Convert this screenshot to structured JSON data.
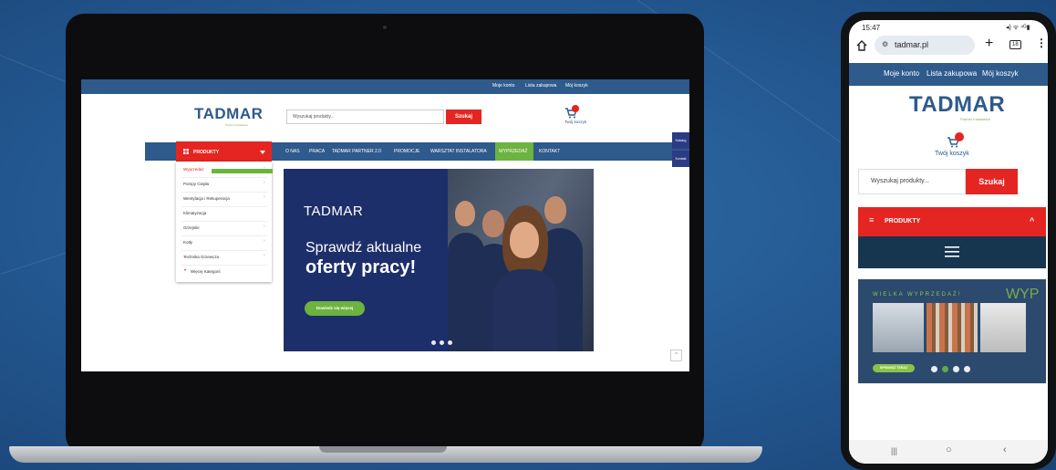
{
  "laptop": {
    "topbar": {
      "links": [
        "Moje konto",
        "Lista zakupowa",
        "Mój koszyk"
      ]
    },
    "header": {
      "logo": "TADMAR",
      "logo_tagline": "Partner Instalatora",
      "search_placeholder": "Wyszukaj produkty...",
      "search_button": "Szukaj",
      "cart_label": "Twój koszyk"
    },
    "nav": {
      "products_label": "PRODUKTY",
      "items": [
        "O NAS",
        "PRACA",
        "TADMAR PARTNER 2.0",
        "PROMOCJE",
        "WARSZTAT INSTALATORA",
        "WYPRZEDAŻ",
        "KONTAKT"
      ]
    },
    "categories": [
      "Wyprzedaż",
      "Pompy Ciepła",
      "Wentylacja i Rekuperacja",
      "Klimatyzacja",
      "Grzejniki",
      "Kotły",
      "Technika Grzewcza",
      "Więcej Kategorii"
    ],
    "side_tabs": [
      "Katalog",
      "Kontakt"
    ],
    "banner": {
      "logo": "TADMAR",
      "line1": "Sprawdź aktualne",
      "line2": "oferty pracy!",
      "button": "Dowiedz się więcej"
    }
  },
  "phone": {
    "status": {
      "time": "15:47",
      "icons": "◂) ᯤ ⁴ᴳ▮"
    },
    "browser": {
      "url": "tadmar.pl",
      "tab_count": "18"
    },
    "topbar": {
      "links": [
        "Moje konto",
        "Lista zakupowa",
        "Mój koszyk"
      ]
    },
    "logo": "TADMAR",
    "logo_tagline": "Partner Instalatora",
    "cart_label": "Twój koszyk",
    "search_placeholder": "Wyszukaj produkty...",
    "search_button": "Szukaj",
    "products_label": "PRODUKTY",
    "banner": {
      "title": "WIELKA WYPRZEDAŻ!",
      "side_text": "WYP",
      "button": "SPRAWDŹ TERAZ"
    }
  },
  "colors": {
    "brand_blue": "#2e5a8c",
    "brand_red": "#e52521",
    "brand_green": "#6cb33f"
  }
}
